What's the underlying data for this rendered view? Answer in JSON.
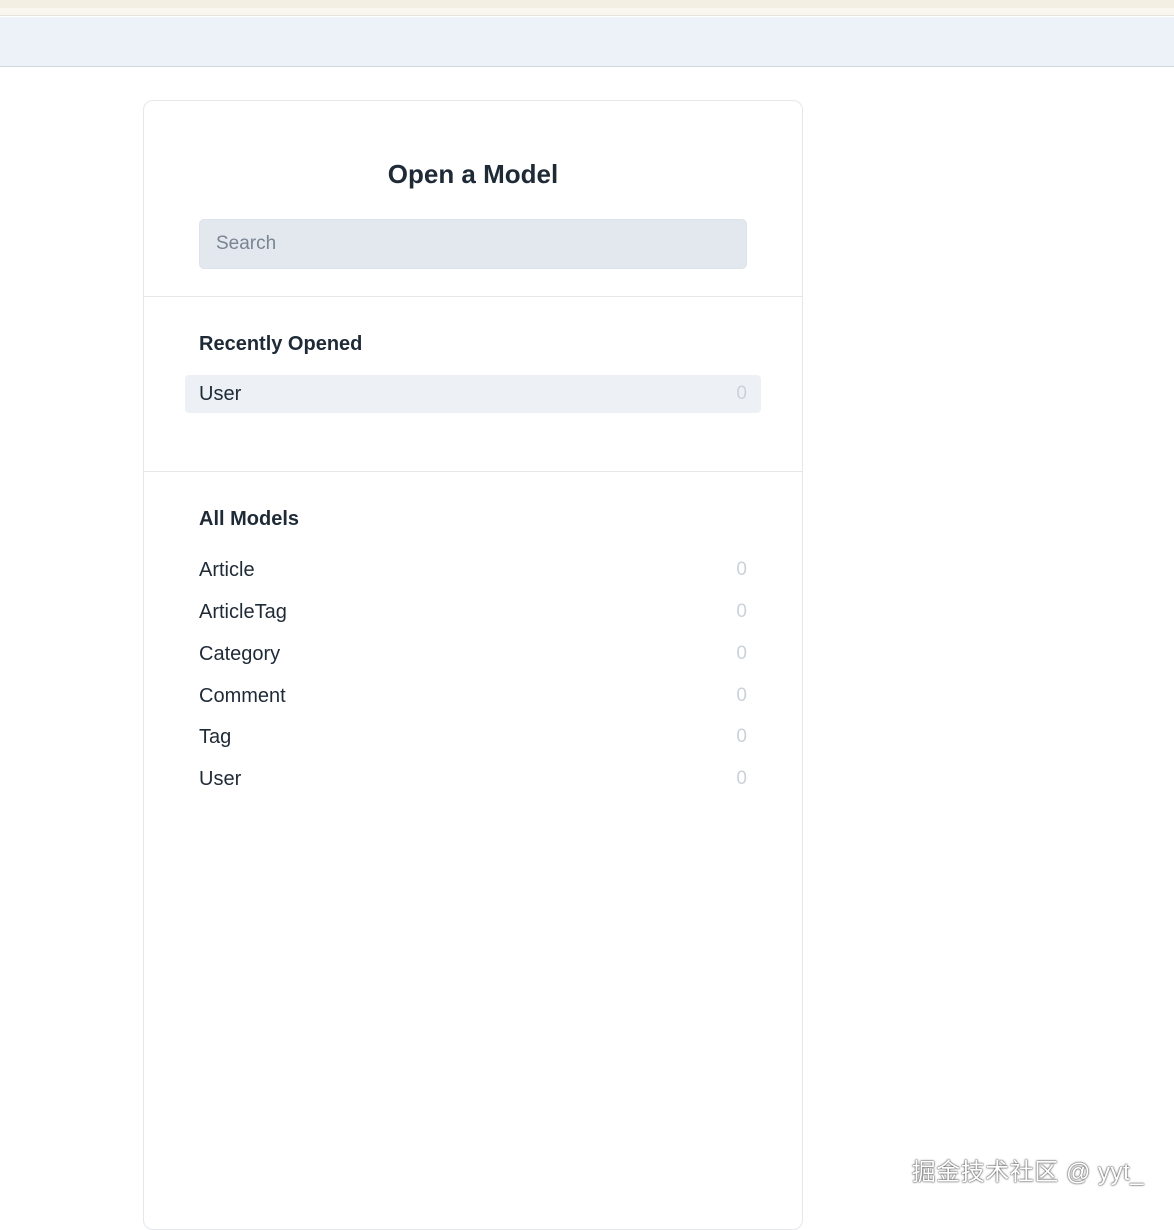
{
  "modal": {
    "title": "Open a Model",
    "search_placeholder": "Search"
  },
  "recent": {
    "title": "Recently Opened",
    "items": [
      {
        "label": "User",
        "count": "0"
      }
    ]
  },
  "all_models": {
    "title": "All Models",
    "items": [
      {
        "label": "Article",
        "count": "0"
      },
      {
        "label": "ArticleTag",
        "count": "0"
      },
      {
        "label": "Category",
        "count": "0"
      },
      {
        "label": "Comment",
        "count": "0"
      },
      {
        "label": "Tag",
        "count": "0"
      },
      {
        "label": "User",
        "count": "0"
      }
    ]
  },
  "watermark": "掘金技术社区 @ yyt_"
}
